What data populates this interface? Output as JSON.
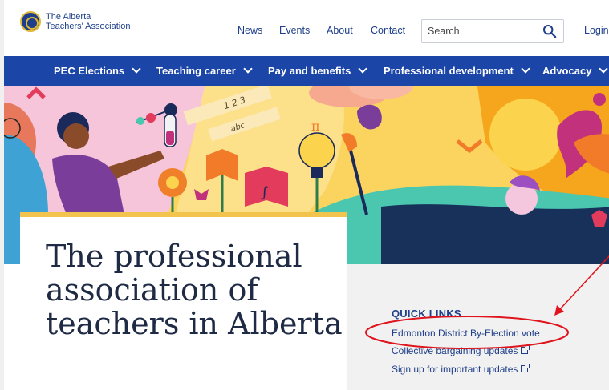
{
  "header": {
    "logo_line1": "The Alberta",
    "logo_line2": "Teachers' Association",
    "nav": [
      "News",
      "Events",
      "About",
      "Contact"
    ],
    "search_placeholder": "Search",
    "login": "Login"
  },
  "mainnav": {
    "items": [
      "PEC Elections",
      "Teaching career",
      "Pay and benefits",
      "Professional development",
      "Advocacy"
    ]
  },
  "hero": {
    "scribble_1": "1 2 3",
    "scribble_2": "abc",
    "scribble_3": "π"
  },
  "content": {
    "headline": "The professional association of teachers in Alberta"
  },
  "quick_links": {
    "title": "QUICK LINKS",
    "links": [
      "Edmonton District By-Election vote",
      "Collective bargaining updates",
      "Sign up for important updates"
    ]
  },
  "colors": {
    "brand_blue": "#1b45a6",
    "accent_gold": "#f2c34d",
    "annotation_red": "#e0141c"
  },
  "icons": {
    "search": "search-icon",
    "nav_chevron": "chevron-down-icon",
    "external": "external-link-icon"
  }
}
